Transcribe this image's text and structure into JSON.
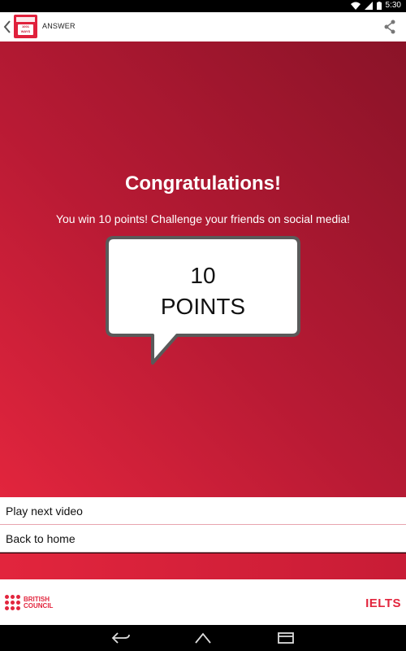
{
  "status_bar": {
    "time": "5:30",
    "icons": [
      "wifi-icon",
      "signal-icon",
      "battery-icon"
    ]
  },
  "app_bar": {
    "title": "ANSWER",
    "logo_text": "1001 WAYS"
  },
  "main": {
    "heading": "Congratulations!",
    "message": "You win 10 points! Challenge your friends on social media!",
    "bubble_line1": "10",
    "bubble_line2": "POINTS"
  },
  "menu": {
    "items": [
      {
        "label": "Play next video"
      },
      {
        "label": "Back to home"
      }
    ]
  },
  "footer": {
    "left_logo_line1": "BRITISH",
    "left_logo_line2": "COUNCIL",
    "right_logo": "IELTS"
  },
  "colors": {
    "brand_red": "#e2253d",
    "dark_red": "#8a1328"
  }
}
